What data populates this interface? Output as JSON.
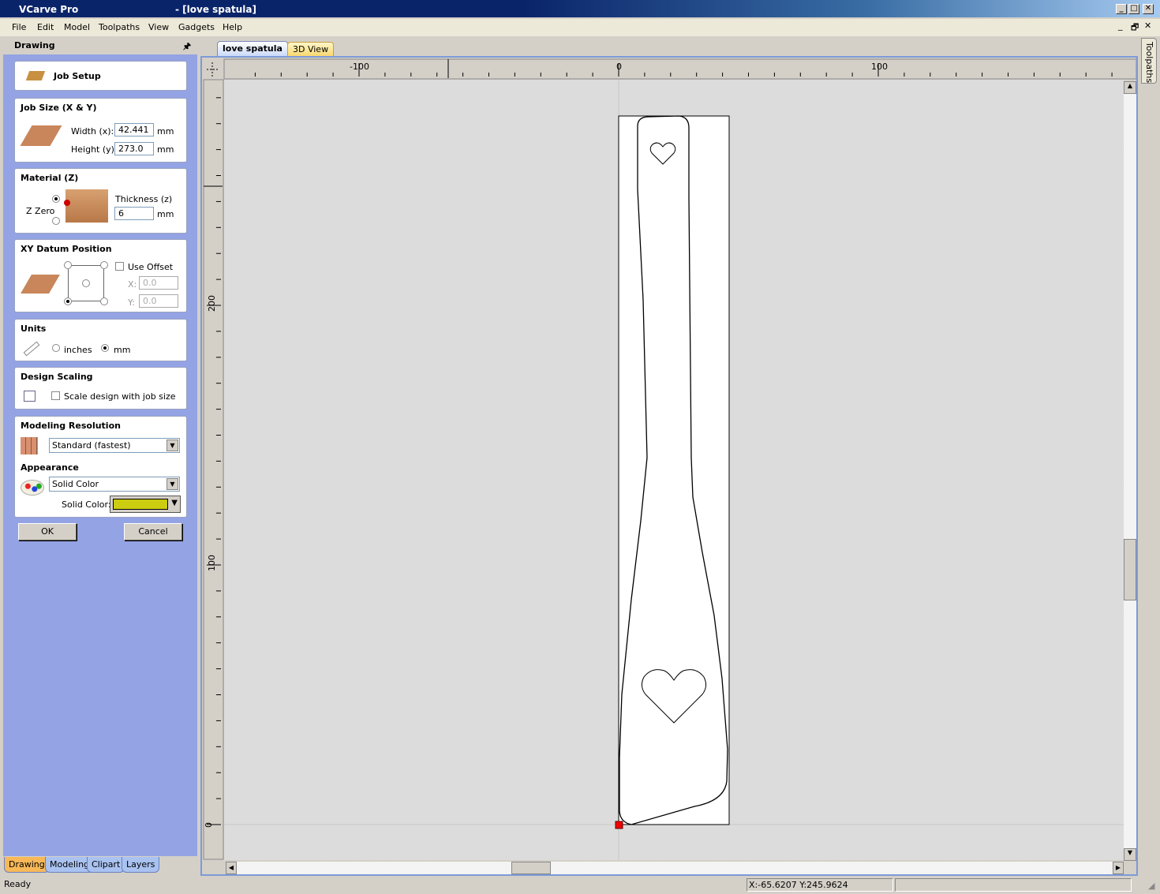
{
  "window": {
    "app": "VCarve Pro",
    "doc": "- [love spatula]"
  },
  "menu": [
    "File",
    "Edit",
    "Model",
    "Toolpaths",
    "View",
    "Gadgets",
    "Help"
  ],
  "panel": {
    "title": "Drawing",
    "job_setup": "Job Setup",
    "job_size": {
      "title": "Job Size (X & Y)",
      "width_label": "Width (x):",
      "width": "42.441",
      "height_label": "Height (y):",
      "height": "273.0",
      "unit": "mm"
    },
    "material": {
      "title": "Material (Z)",
      "z_zero": "Z Zero",
      "thickness_label": "Thickness (z)",
      "thickness": "6",
      "unit": "mm"
    },
    "datum": {
      "title": "XY Datum Position",
      "use_offset": "Use Offset",
      "x_label": "X:",
      "x": "0.0",
      "y_label": "Y:",
      "y": "0.0"
    },
    "units": {
      "title": "Units",
      "inches": "inches",
      "mm": "mm",
      "selected": "mm"
    },
    "scaling": {
      "title": "Design Scaling",
      "label": "Scale design with job size"
    },
    "resolution": {
      "title": "Modeling Resolution",
      "value": "Standard (fastest)"
    },
    "appearance": {
      "title": "Appearance",
      "value": "Solid Color",
      "color_label": "Solid Color:",
      "color": "#cccc10"
    },
    "ok": "OK",
    "cancel": "Cancel",
    "tabs": [
      "Drawing",
      "Modeling",
      "Clipart",
      "Layers"
    ]
  },
  "view": {
    "tabs": [
      "love spatula",
      "3D View"
    ],
    "ruler_x": [
      "-100",
      "0",
      "100"
    ],
    "ruler_y": [
      "200",
      "100",
      "0"
    ],
    "side_tab": "Toolpaths"
  },
  "status": {
    "text": "Ready",
    "coords": "X:-65.6207 Y:245.9624"
  }
}
